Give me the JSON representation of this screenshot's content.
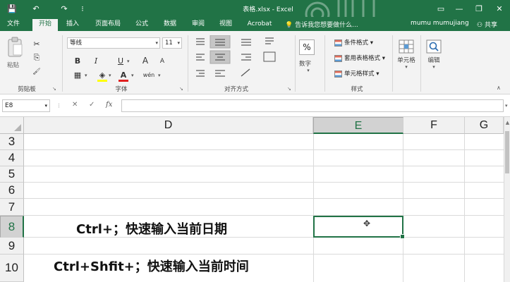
{
  "window": {
    "title": "表格.xlsx - Excel",
    "min_glyph": "—",
    "restore_glyph": "❐",
    "close_glyph": "✕",
    "ribbon_display_glyph": "▭"
  },
  "quick_access": {
    "save_glyph": "💾",
    "undo_glyph": "↶",
    "redo_glyph": "↷",
    "customize_glyph": "⁝"
  },
  "tabs": [
    {
      "label": "文件"
    },
    {
      "label": "开始"
    },
    {
      "label": "插入"
    },
    {
      "label": "页面布局"
    },
    {
      "label": "公式"
    },
    {
      "label": "数据"
    },
    {
      "label": "审阅"
    },
    {
      "label": "视图"
    },
    {
      "label": "Acrobat"
    }
  ],
  "tellme": {
    "icon": "💡",
    "text": "告诉我您想要做什么..."
  },
  "user": {
    "name": "mumu mumujiang"
  },
  "share": {
    "icon": "⚇",
    "label": "共享"
  },
  "ribbon": {
    "clipboard": {
      "paste_label": "粘贴",
      "group_label": "剪贴板",
      "cut_glyph": "✂",
      "copy_glyph": "⎘",
      "brush_glyph": "🖌"
    },
    "font": {
      "font_name": "等线",
      "font_size": "11",
      "group_label": "字体",
      "bold": "B",
      "italic": "I",
      "underline": "U",
      "grow": "A",
      "shrink": "A",
      "border_glyph": "▦",
      "fill_glyph": "◈",
      "color_glyph": "A",
      "wen_glyph": "wén"
    },
    "alignment": {
      "group_label": "对齐方式"
    },
    "number": {
      "button_label": "数字",
      "symbol": "%"
    },
    "styles": {
      "group_label": "样式",
      "items": [
        {
          "label": "条件格式 ▾"
        },
        {
          "label": "套用表格格式 ▾"
        },
        {
          "label": "单元格样式 ▾"
        }
      ]
    },
    "cells": {
      "label": "单元格"
    },
    "editing": {
      "label": "编辑"
    }
  },
  "formula_bar": {
    "name_box": "E8",
    "cancel_glyph": "✕",
    "enter_glyph": "✓",
    "fx_label": "fx",
    "formula": ""
  },
  "columns": [
    {
      "label": "D"
    },
    {
      "label": "E"
    },
    {
      "label": "F"
    },
    {
      "label": "G"
    }
  ],
  "rows": [
    {
      "label": "3"
    },
    {
      "label": "4"
    },
    {
      "label": "5"
    },
    {
      "label": "6"
    },
    {
      "label": "7"
    },
    {
      "label": "8"
    },
    {
      "label": "9"
    },
    {
      "label": "10"
    }
  ],
  "cells": {
    "d8": "Ctrl+；快速输入当前日期",
    "d10": "Ctrl+Shfit+；快速输入当前时间"
  }
}
